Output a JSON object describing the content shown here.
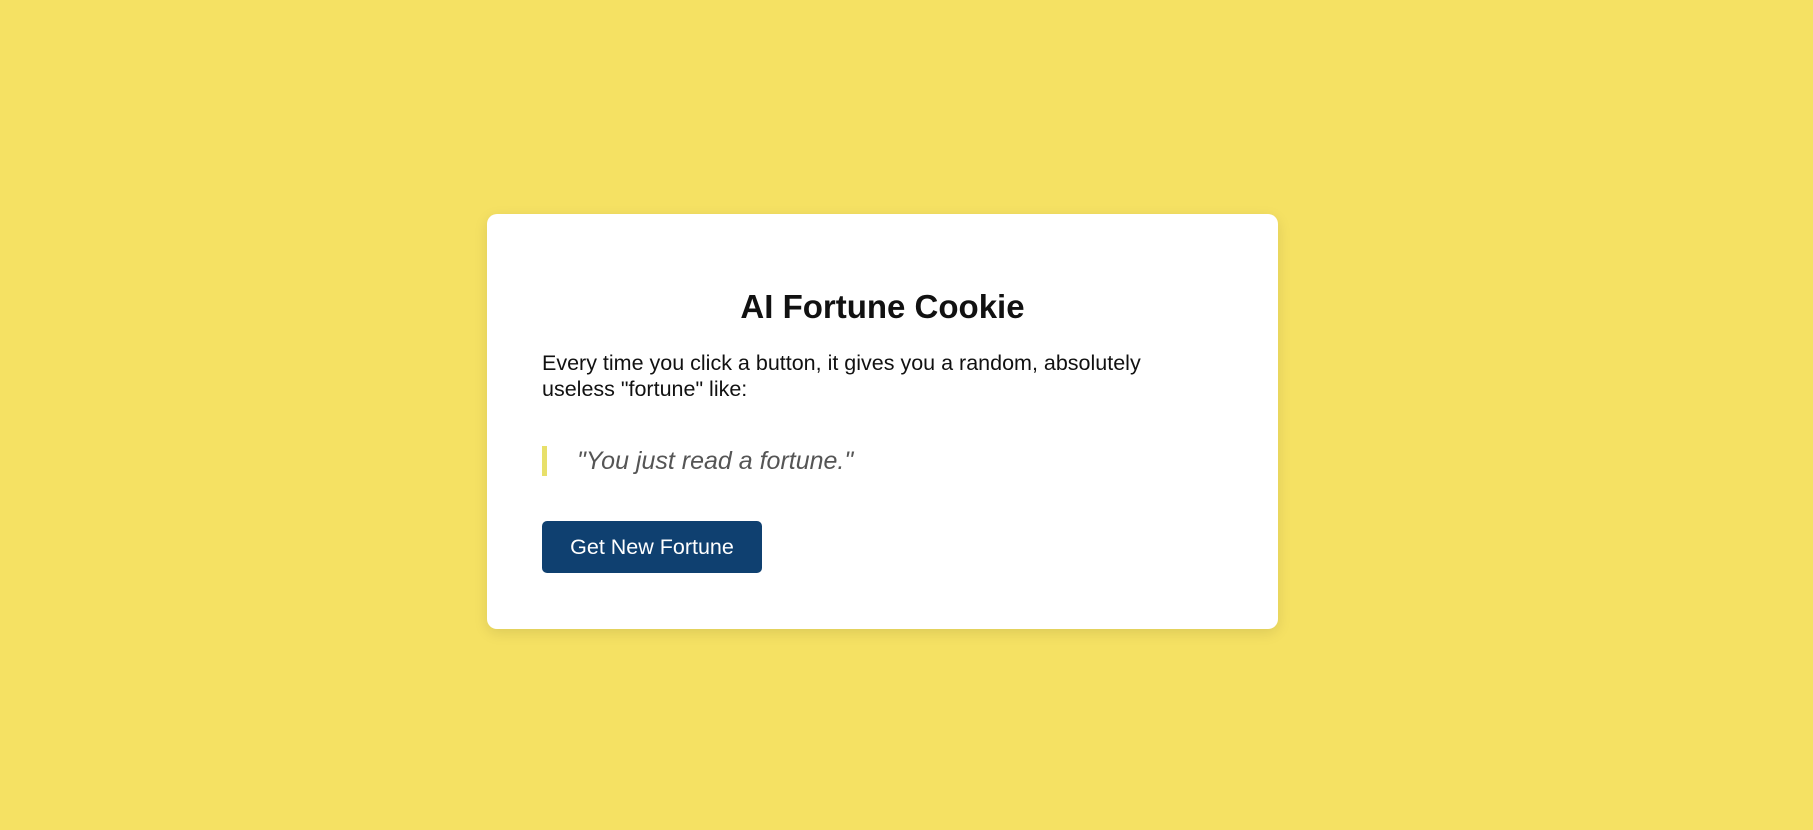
{
  "theme": {
    "background": "#f5e163",
    "card": "#ffffff",
    "quote_border": "#e8e06a",
    "button": "#0f4070"
  },
  "card": {
    "title": "AI Fortune Cookie",
    "description": "Every time you click a button, it gives you a random, absolutely useless \"fortune\" like:",
    "fortune": "\"You just read a fortune.\"",
    "button_label": "Get New Fortune"
  }
}
